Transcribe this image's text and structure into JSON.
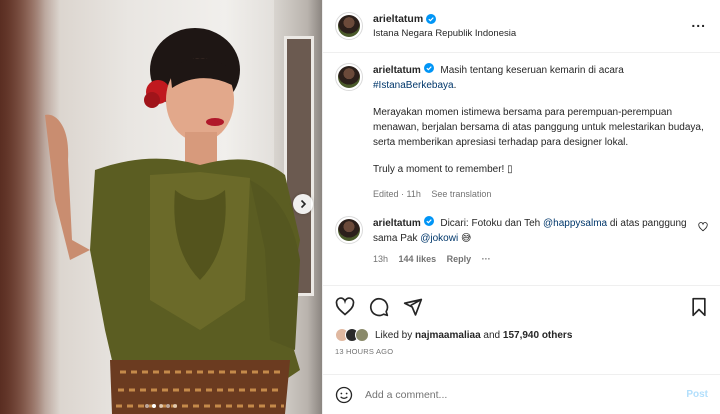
{
  "header": {
    "username": "arieltatum",
    "location": "Istana Negara Republik Indonesia",
    "more_label": "..."
  },
  "caption": {
    "username": "arieltatum",
    "line1": "Masih tentang keseruan kemarin di acara",
    "hashtag": "#IstanaBerkebaya",
    "hashtag_end": ".",
    "para2": "Merayakan momen istimewa bersama para perempuan-perempuan menawan, berjalan bersama di atas panggung untuk melestarikan budaya, serta memberikan apresiasi terhadap para designer lokal.",
    "para3": "Truly a moment to remember! ▯",
    "edited": "Edited · 11h",
    "see_translation": "See translation"
  },
  "comment": {
    "username": "arieltatum",
    "text_a": "Dicari: Fotoku dan Teh",
    "mention1": "@happysalma",
    "text_b": "di atas panggung sama Pak",
    "mention2": "@jokowi",
    "emoji": "😅",
    "time": "13h",
    "likes": "144 likes",
    "reply": "Reply",
    "more": "···"
  },
  "likes": {
    "prefix": "Liked by",
    "user": "najmaamaliaa",
    "and": "and",
    "others": "157,940 others"
  },
  "timestamp": "13 HOURS AGO",
  "add_comment": {
    "placeholder": "Add a comment...",
    "post_label": "Post"
  },
  "colors": {
    "verified": "#0095f6",
    "link": "#00376b",
    "post_disabled": "#b2dffc",
    "muted": "#737373"
  },
  "carousel": {
    "current_index": 2,
    "total": 5
  }
}
